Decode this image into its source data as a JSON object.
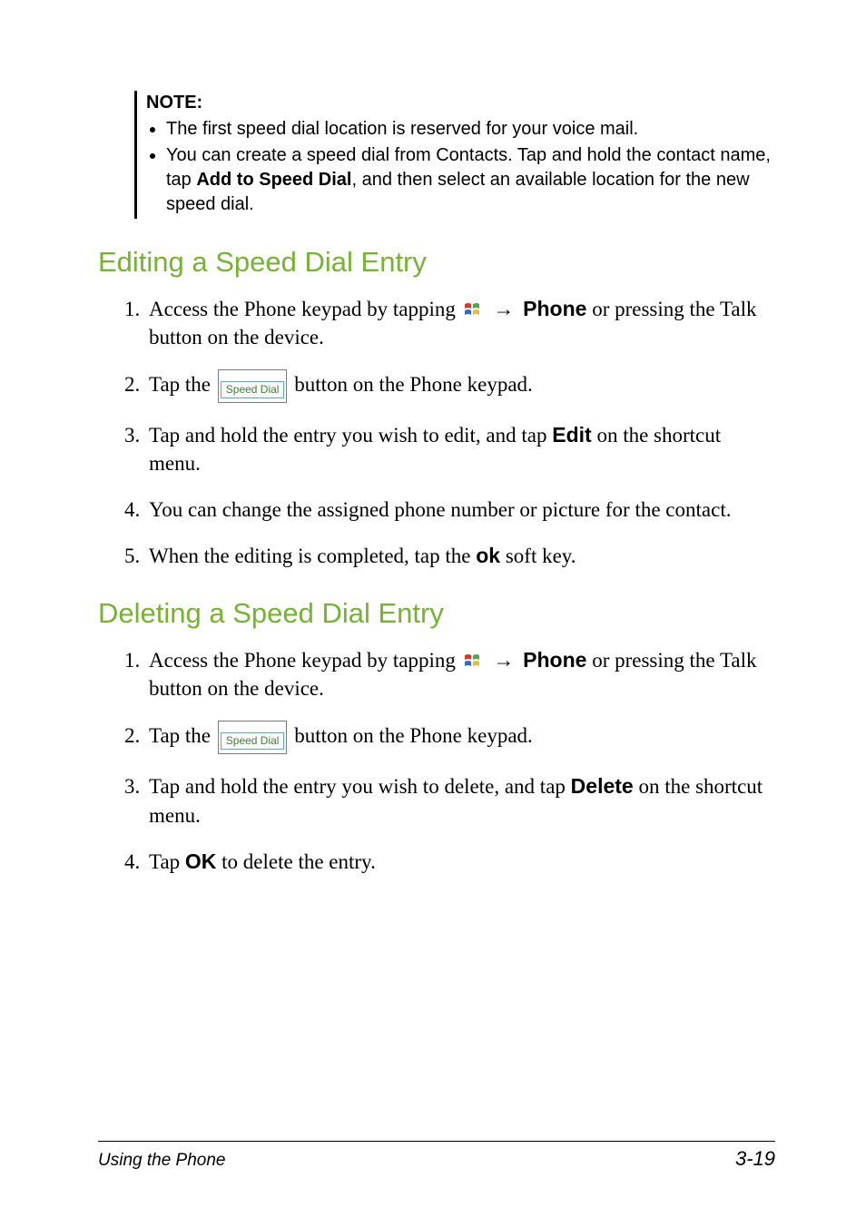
{
  "note": {
    "title": "NOTE:",
    "bullets": [
      {
        "text": "The first speed dial location is reserved for your voice mail."
      },
      {
        "pre": "You can create a speed dial from Contacts. Tap and hold the contact name, tap ",
        "bold": "Add to Speed Dial",
        "post": ", and then select an available location for the new speed dial."
      }
    ]
  },
  "sections": {
    "edit": {
      "heading": "Editing a Speed Dial Entry",
      "steps": [
        {
          "pre": "Access the Phone keypad by tapping ",
          "icon": "win",
          "arrow": "→",
          "bold": "Phone",
          "post": " or pressing the Talk button on the device."
        },
        {
          "pre": "Tap the ",
          "btn": "Speed Dial",
          "post": " button on the Phone keypad."
        },
        {
          "pre": "Tap and hold the entry you wish to edit, and tap ",
          "bold": "Edit",
          "post": " on the shortcut menu."
        },
        {
          "text": "You can change the assigned phone number or picture for the contact."
        },
        {
          "pre": "When the editing is completed, tap the ",
          "bold": "ok",
          "post": " soft key."
        }
      ]
    },
    "delete": {
      "heading": "Deleting a Speed Dial Entry",
      "steps": [
        {
          "pre": "Access the Phone keypad by tapping ",
          "icon": "win",
          "arrow": "→",
          "bold": "Phone",
          "post": " or pressing the Talk button on the device."
        },
        {
          "pre": "Tap the ",
          "btn": "Speed Dial",
          "post": " button on the Phone keypad."
        },
        {
          "pre": "Tap and hold the entry you wish to delete, and tap ",
          "bold": "Delete",
          "post": " on the shortcut menu."
        },
        {
          "pre": "Tap ",
          "bold": "OK",
          "post": " to delete the entry."
        }
      ]
    }
  },
  "footer": {
    "left": "Using the Phone",
    "right": "3-19"
  },
  "ui": {
    "arrow_glyph": "→"
  }
}
